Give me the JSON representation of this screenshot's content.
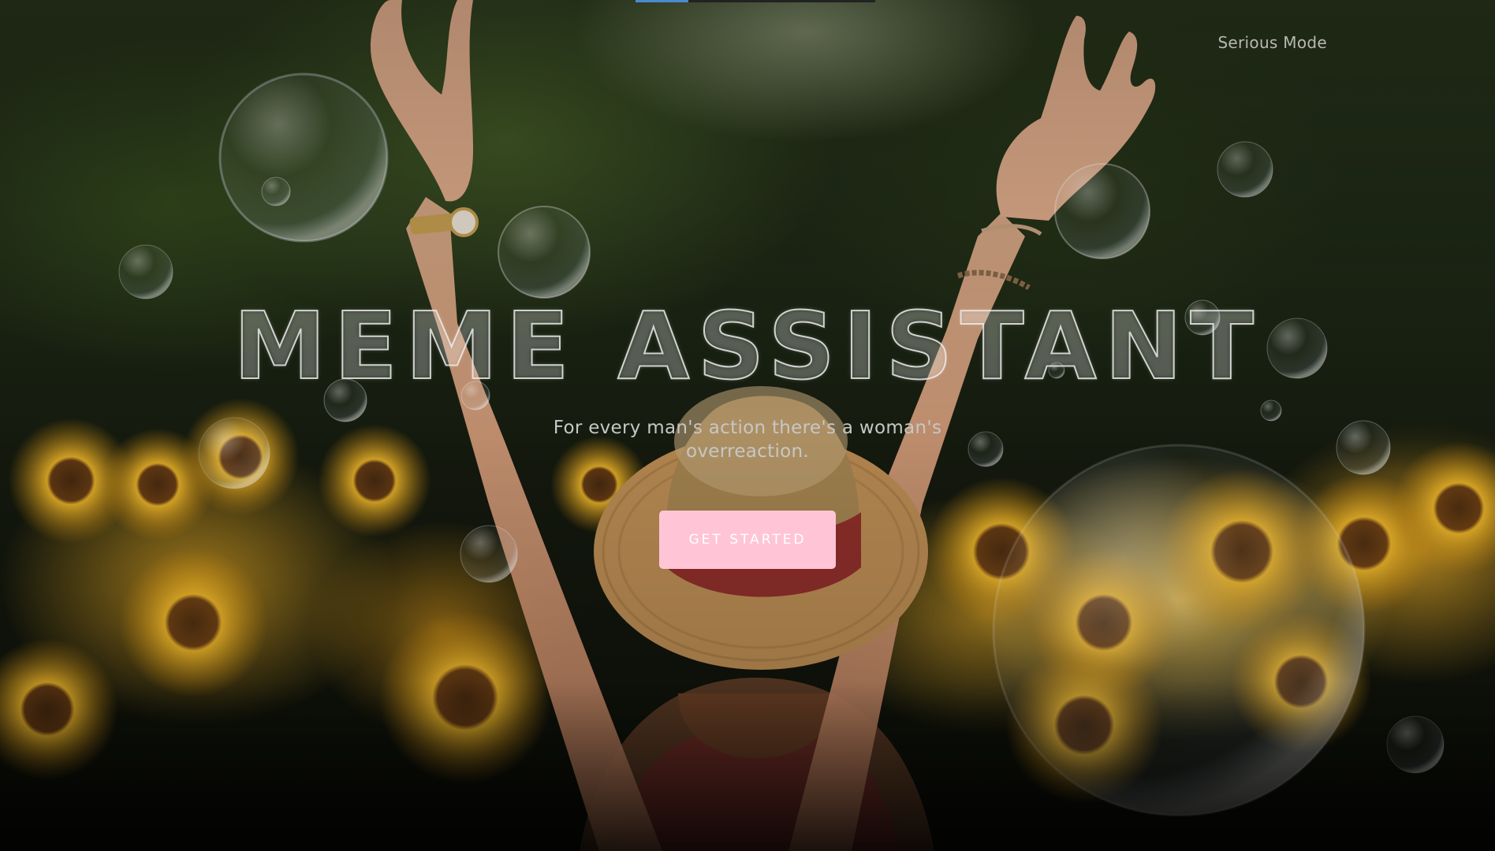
{
  "header": {
    "mode_toggle_label": "Serious Mode"
  },
  "hero": {
    "title": "MEME ASSISTANT",
    "subtitle": "For every man's action there's a woman's overreaction.",
    "cta_label": "GET STARTED"
  },
  "colors": {
    "cta_background": "#ffc5d6",
    "subtitle_text": "#c7c7c4"
  },
  "background": {
    "image": "woman-in-sunflower-field-with-bubbles"
  }
}
